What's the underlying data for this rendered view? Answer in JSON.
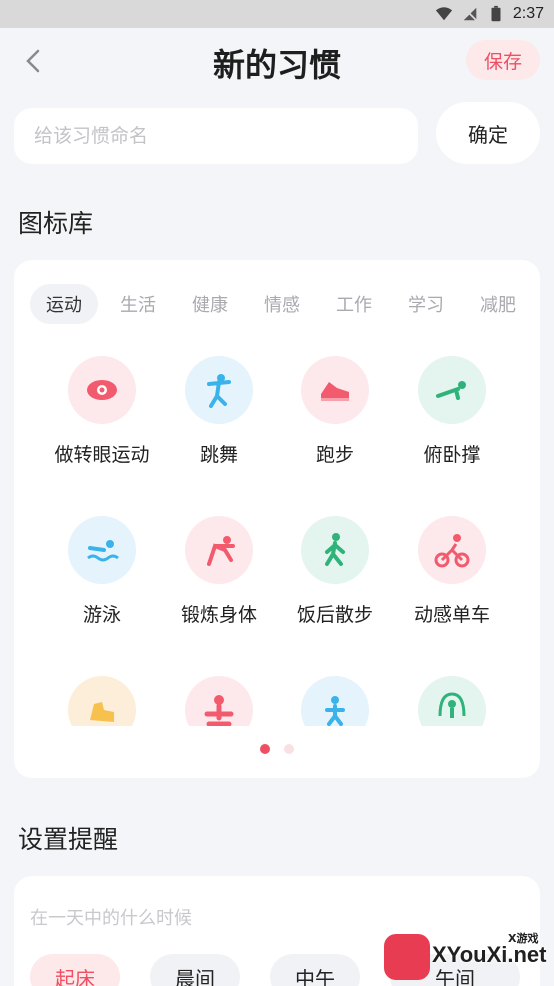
{
  "status": {
    "time": "2:37"
  },
  "header": {
    "title": "新的习惯",
    "save_label": "保存"
  },
  "name_form": {
    "placeholder": "给该习惯命名",
    "confirm_label": "确定"
  },
  "icon_library": {
    "title": "图标库",
    "tabs": [
      "运动",
      "生活",
      "健康",
      "情感",
      "工作",
      "学习",
      "减肥"
    ],
    "active_tab": "运动",
    "items": [
      {
        "label": "做转眼运动",
        "icon": "eye-icon",
        "bg": "pink"
      },
      {
        "label": "跳舞",
        "icon": "dance-icon",
        "bg": "blue"
      },
      {
        "label": "跑步",
        "icon": "running-shoe-icon",
        "bg": "pink"
      },
      {
        "label": "俯卧撑",
        "icon": "pushup-icon",
        "bg": "green"
      },
      {
        "label": "游泳",
        "icon": "swimming-icon",
        "bg": "blue"
      },
      {
        "label": "锻炼身体",
        "icon": "stretching-icon",
        "bg": "pink"
      },
      {
        "label": "饭后散步",
        "icon": "walking-icon",
        "bg": "green"
      },
      {
        "label": "动感单车",
        "icon": "cycling-icon",
        "bg": "pink"
      },
      {
        "label": "",
        "icon": "muscle-icon",
        "bg": "peach"
      },
      {
        "label": "",
        "icon": "yoga-icon",
        "bg": "pink"
      },
      {
        "label": "",
        "icon": "jogging-icon",
        "bg": "blue"
      },
      {
        "label": "",
        "icon": "jump-rope-icon",
        "bg": "green"
      }
    ],
    "page_count": 2,
    "current_page": 1
  },
  "reminder": {
    "title": "设置提醒",
    "hint": "在一天中的什么时候",
    "times": [
      "起床",
      "晨间",
      "中午",
      "午间"
    ],
    "active_time": "起床"
  },
  "watermark": {
    "site": "XYouXi.net",
    "small": "X游戏"
  },
  "colors": {
    "accent": "#ee4f62",
    "accent_light": "#fde8ea",
    "background": "#f4f5f8"
  }
}
